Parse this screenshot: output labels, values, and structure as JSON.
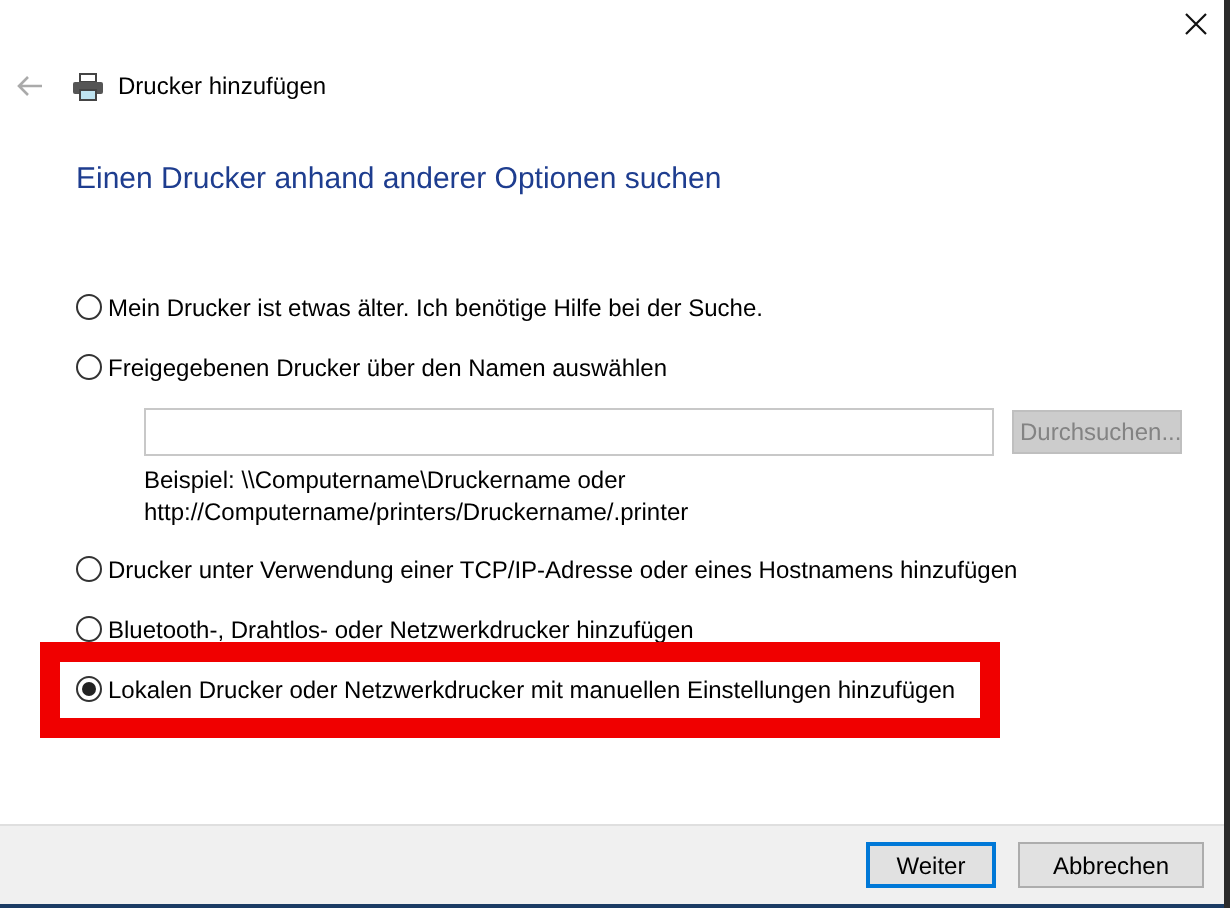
{
  "window": {
    "title": "Drucker hinzufügen"
  },
  "heading": "Einen Drucker anhand anderer Optionen suchen",
  "options": [
    {
      "label": "Mein Drucker ist etwas älter. Ich benötige Hilfe bei der Suche.",
      "selected": false,
      "highlighted": false
    },
    {
      "label": "Freigegebenen Drucker über den Namen auswählen",
      "selected": false,
      "highlighted": false,
      "browse_button": {
        "label": "Durchsuchen...",
        "disabled": true
      },
      "hint": [
        "Beispiel: \\\\Computername\\Druckername oder",
        "http://Computername/printers/Druckername/.printer"
      ]
    },
    {
      "label": "Drucker unter Verwendung einer TCP/IP-Adresse oder eines Hostnamens hinzufügen",
      "selected": false,
      "highlighted": false
    },
    {
      "label": "Bluetooth-, Drahtlos- oder Netzwerkdrucker hinzufügen",
      "selected": false,
      "highlighted": false
    },
    {
      "label": "Lokalen Drucker oder Netzwerkdrucker mit manuellen Einstellungen hinzufügen",
      "selected": true,
      "highlighted": true
    }
  ],
  "buttons": [
    {
      "label": "Weiter",
      "default": true
    },
    {
      "label": "Abbrechen",
      "default": false
    }
  ]
}
